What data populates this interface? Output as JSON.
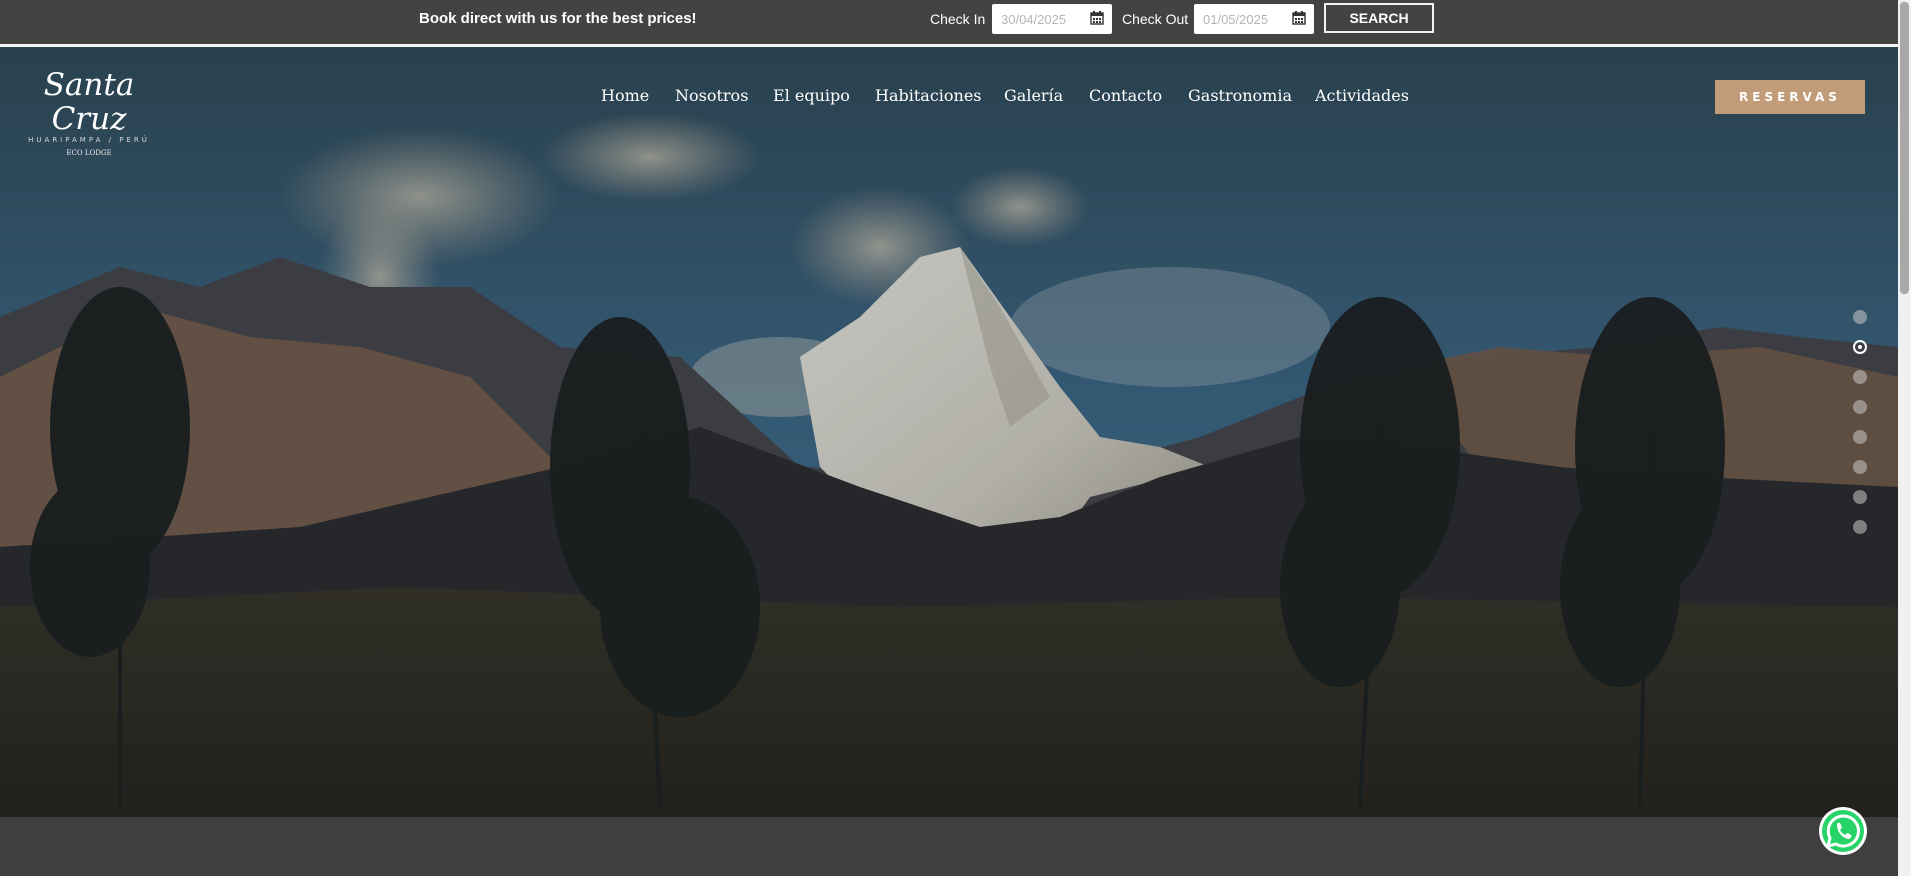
{
  "topbar": {
    "promo": "Book direct with us for the best prices!",
    "check_in_label": "Check In",
    "check_in_value": "30/04/2025",
    "check_out_label": "Check Out",
    "check_out_value": "01/05/2025",
    "search_label": "SEARCH",
    "calendar_icon": "calendar-icon"
  },
  "logo": {
    "name": "Santa Cruz",
    "subtitle": "HUARIPAMPA / PERÚ",
    "tagline": "ECO LODGE"
  },
  "nav": {
    "items": [
      {
        "label": "Home"
      },
      {
        "label": "Nosotros"
      },
      {
        "label": "El equipo"
      },
      {
        "label": "Habitaciones"
      },
      {
        "label": "Galería"
      },
      {
        "label": "Contacto"
      },
      {
        "label": "Gastronomia"
      },
      {
        "label": "Actividades"
      }
    ]
  },
  "reservas_label": "RESERVAS",
  "slider": {
    "count": 8,
    "active_index": 1
  },
  "icons": {
    "whatsapp": "whatsapp-icon"
  },
  "colors": {
    "topbar_bg": "#434343",
    "reservas_bg": "#c29c78",
    "whatsapp": "#25d366"
  }
}
